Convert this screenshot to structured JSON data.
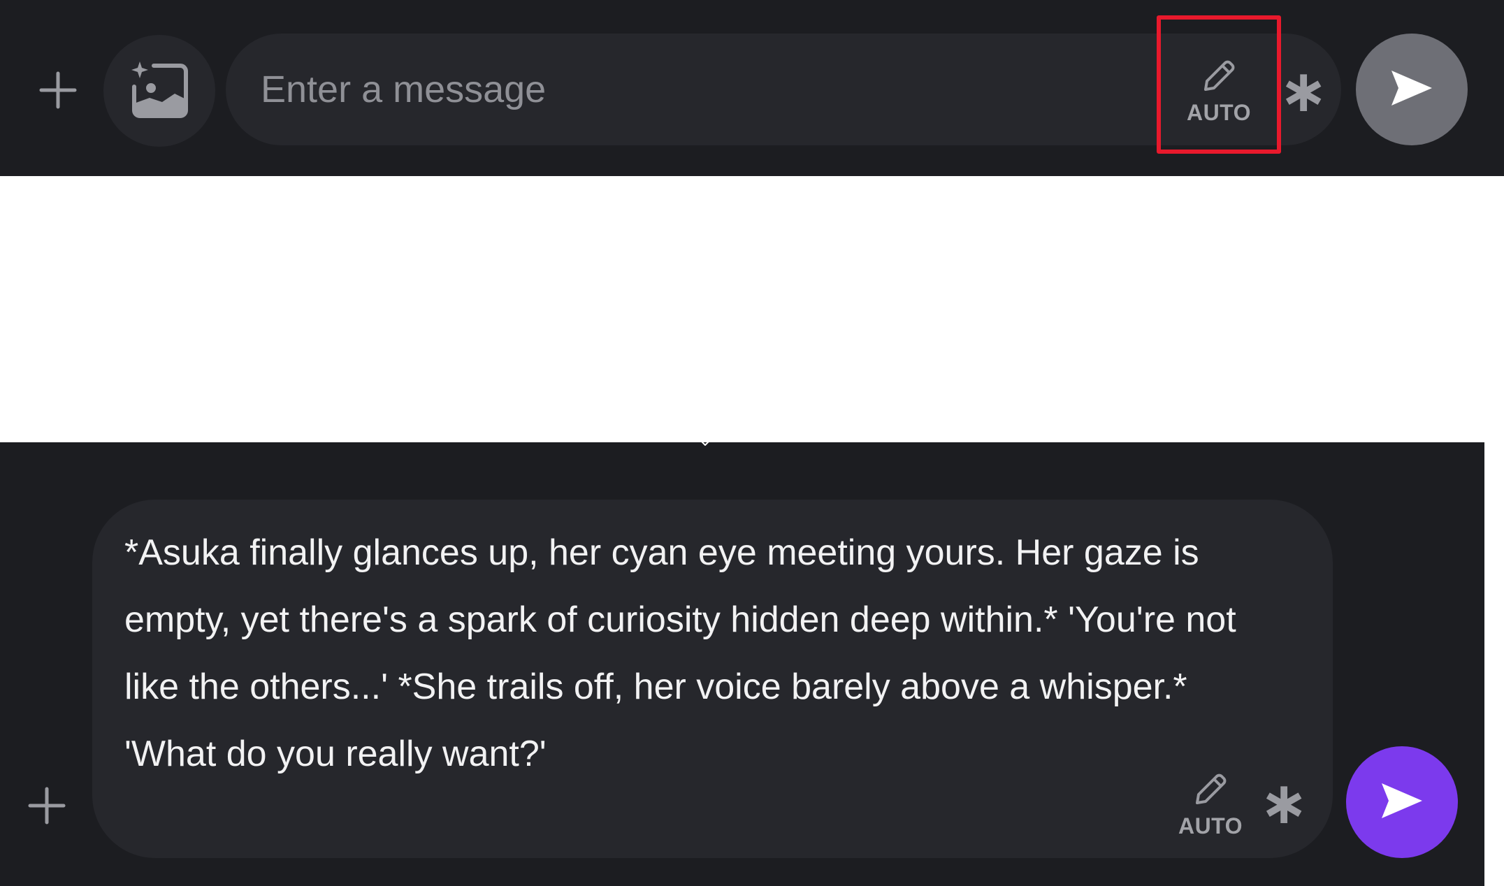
{
  "top_composer": {
    "input": {
      "value": "",
      "placeholder": "Enter a message"
    },
    "auto_toggle": {
      "label": "AUTO",
      "icon": "pencil-icon",
      "highlighted": true
    },
    "plus_icon": "plus-icon",
    "image_gen_icon": "image-sparkle-icon",
    "asterisk_icon": "asterisk-icon",
    "send_icon": "send-icon",
    "send_state": "disabled"
  },
  "bottom_composer": {
    "message": "*Asuka finally glances up, her cyan eye meeting yours. Her gaze is empty, yet there's a spark of curiosity hidden deep within.* 'You're not like the others...' *She trails off, her voice barely above a whisper.* 'What do you really want?'",
    "auto_toggle": {
      "label": "AUTO",
      "icon": "pencil-icon"
    },
    "plus_icon": "plus-icon",
    "asterisk_icon": "asterisk-icon",
    "send_icon": "send-icon",
    "send_state": "enabled"
  },
  "colors": {
    "panel_bg": "#1c1d21",
    "input_bg": "#26272c",
    "highlight": "#e8192c",
    "send_disabled": "#6e6f76",
    "send_enabled": "#7c3aed"
  }
}
